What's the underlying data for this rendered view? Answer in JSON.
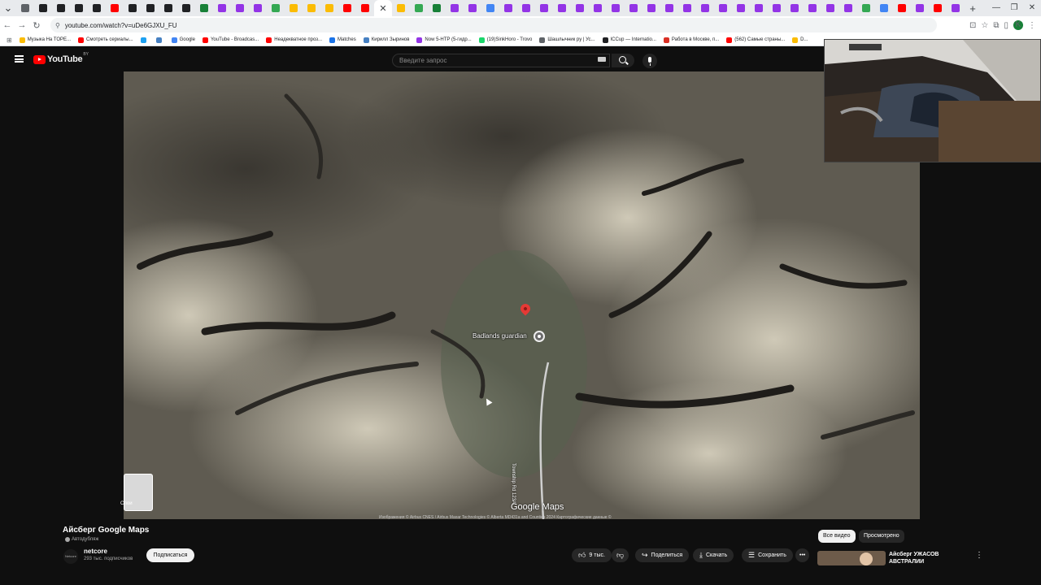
{
  "browser": {
    "tabs": [
      {
        "color": "#5f6368"
      },
      {
        "color": "#202124"
      },
      {
        "color": "#202124"
      },
      {
        "color": "#202124"
      },
      {
        "color": "#202124"
      },
      {
        "color": "#ff0000"
      },
      {
        "color": "#202124"
      },
      {
        "color": "#202124"
      },
      {
        "color": "#202124"
      },
      {
        "color": "#202124"
      },
      {
        "color": "#188038"
      },
      {
        "color": "#9334e6"
      },
      {
        "color": "#9334e6"
      },
      {
        "color": "#9334e6"
      },
      {
        "color": "#34a853"
      },
      {
        "color": "#fbbc04"
      },
      {
        "color": "#fbbc04"
      },
      {
        "color": "#fbbc04"
      },
      {
        "color": "#ff0000"
      },
      {
        "color": "#ff0000"
      },
      {
        "color": "#ffffff",
        "active": true
      },
      {
        "color": "#fbbc04"
      },
      {
        "color": "#34a853"
      },
      {
        "color": "#188038"
      },
      {
        "color": "#9334e6"
      },
      {
        "color": "#9334e6"
      },
      {
        "color": "#4285f4"
      },
      {
        "color": "#9334e6"
      },
      {
        "color": "#9334e6"
      },
      {
        "color": "#9334e6"
      },
      {
        "color": "#9334e6"
      },
      {
        "color": "#9334e6"
      },
      {
        "color": "#9334e6"
      },
      {
        "color": "#9334e6"
      },
      {
        "color": "#9334e6"
      },
      {
        "color": "#9334e6"
      },
      {
        "color": "#9334e6"
      },
      {
        "color": "#9334e6"
      },
      {
        "color": "#9334e6"
      },
      {
        "color": "#9334e6"
      },
      {
        "color": "#9334e6"
      },
      {
        "color": "#9334e6"
      },
      {
        "color": "#9334e6"
      },
      {
        "color": "#9334e6"
      },
      {
        "color": "#9334e6"
      },
      {
        "color": "#9334e6"
      },
      {
        "color": "#9334e6"
      },
      {
        "color": "#34a853"
      },
      {
        "color": "#4285f4"
      },
      {
        "color": "#ff0000"
      },
      {
        "color": "#9334e6"
      },
      {
        "color": "#ff0000"
      },
      {
        "color": "#9334e6"
      }
    ],
    "url": "youtube.com/watch?v=uDe6GJXU_FU",
    "bookmarks": [
      {
        "label": "Музыка На ТОРЕ...",
        "color": "#fbbc04"
      },
      {
        "label": "Смотреть сериалы...",
        "color": "#ff0000"
      },
      {
        "label": "",
        "color": "#1da1f2"
      },
      {
        "label": "",
        "color": "#4680c2"
      },
      {
        "label": "Google",
        "color": "#4285f4"
      },
      {
        "label": "YouTube - Broadcas...",
        "color": "#ff0000"
      },
      {
        "label": "Неадекватное проз...",
        "color": "#ff0000"
      },
      {
        "label": "Matches",
        "color": "#1a73e8"
      },
      {
        "label": "Кирилл Зыринов",
        "color": "#4680c2"
      },
      {
        "label": "Now 5-HTP (5-гидр...",
        "color": "#9334e6"
      },
      {
        "label": "(19)SinkHoro - Trovo",
        "color": "#19d66b"
      },
      {
        "label": "Шашлычник ру | Ус...",
        "color": "#5f6368"
      },
      {
        "label": "ICCup — Internatio...",
        "color": "#202124"
      },
      {
        "label": "Работа в Москве, п...",
        "color": "#d93025"
      },
      {
        "label": "(562) Самые страны...",
        "color": "#ff0000"
      },
      {
        "label": "D...",
        "color": "#fbbc04"
      }
    ]
  },
  "youtube": {
    "logo_text": "YouTube",
    "country": "BY",
    "search_placeholder": "Введите запрос"
  },
  "map": {
    "place_label": "Badlands guardian",
    "road_label": "Township Rd 123A",
    "layers_label": "Слои",
    "brand": "Google Maps",
    "attribution": "Изображения © Airbus CNES / Airbus Maxar Technologies © Alberta MD431a and Counties 2024 Картографические данные ©"
  },
  "video": {
    "title": "Айсберг Google Maps",
    "dub_label": "Автодубляж",
    "channel_name": "netcore",
    "channel_avatar_text": "Netcore",
    "subscribers": "293 тыс. подписчиков",
    "subscribe_label": "Подписаться",
    "likes": "9 тыс.",
    "share_label": "Поделиться",
    "download_label": "Скачать",
    "save_label": "Сохранить"
  },
  "sidebar": {
    "chip_all": "Все видео",
    "chip_viewed": "Просмотрено",
    "rec_title": "Айсберг УЖАСОВ АВСТРАЛИИ"
  }
}
